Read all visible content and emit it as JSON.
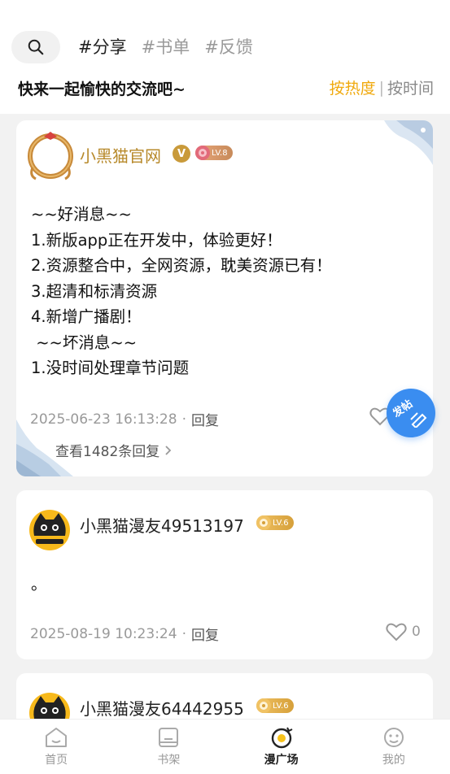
{
  "header": {
    "tags": [
      "#分享",
      "#书单",
      "#反馈"
    ],
    "subtitle": "快来一起愉快的交流吧~",
    "sort_hot": "按热度",
    "sort_sep": "|",
    "sort_time": "按时间"
  },
  "posts": [
    {
      "username": "小黑猫官网",
      "vip_badge": "V",
      "level": "LV.8",
      "content": "~~好消息~~\n1.新版app正在开发中，体验更好！\n2.资源整合中，全网资源，耽美资源已有！\n3.超清和标清资源\n4.新增广播剧！\n ~~坏消息~~\n1.没时间处理章节问题",
      "timestamp": "2025-06-23 16:13:28",
      "reply_label": "回复",
      "view_replies": "查看1482条回复"
    },
    {
      "username": "小黑猫漫友49513197",
      "level": "LV.6",
      "content": "。",
      "timestamp": "2025-08-19 10:23:24",
      "reply_label": "回复",
      "likes": "0"
    },
    {
      "username": "小黑猫漫友64442955",
      "level": "LV.6"
    }
  ],
  "fab": {
    "label": "发帖"
  },
  "tabbar": {
    "items": [
      {
        "label": "首页",
        "icon": "home-icon"
      },
      {
        "label": "书架",
        "icon": "bookshelf-icon"
      },
      {
        "label": "漫广场",
        "icon": "plaza-icon"
      },
      {
        "label": "我的",
        "icon": "profile-icon"
      }
    ],
    "active": "漫广场"
  },
  "colors": {
    "accent": "#f0a90d",
    "fab": "#3a8df0",
    "official_name": "#b7892a"
  }
}
